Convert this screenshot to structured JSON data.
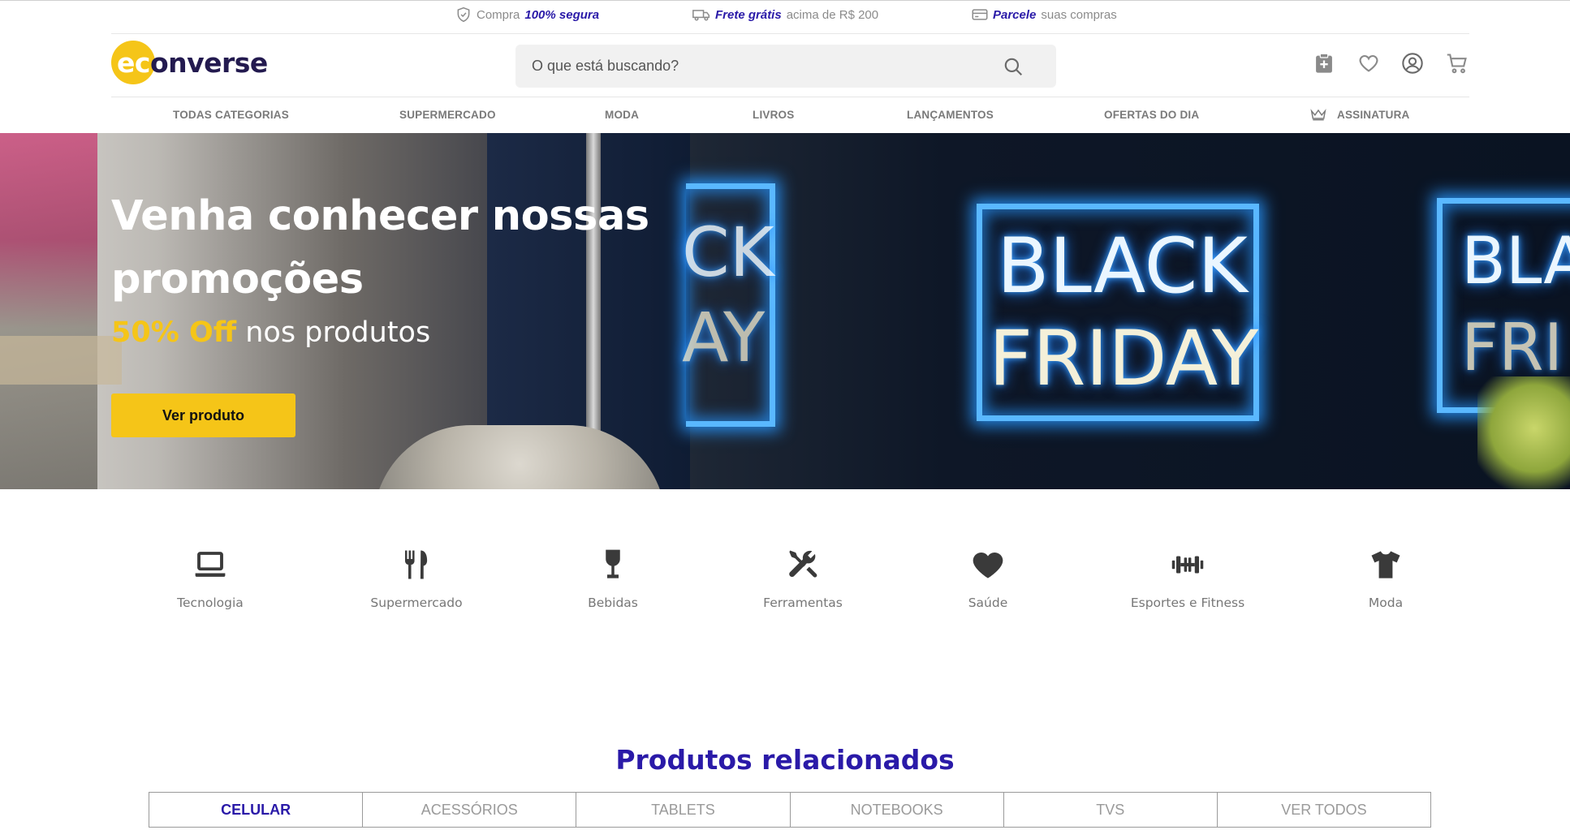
{
  "topbar": {
    "secure": {
      "prefix": "Compra",
      "highlight": "100% segura"
    },
    "shipping": {
      "highlight": "Frete grátis",
      "suffix": "acima de R$ 200"
    },
    "installments": {
      "highlight": "Parcele",
      "suffix": "suas compras"
    }
  },
  "header": {
    "logo": {
      "ec": "ec",
      "rest": "onverse"
    },
    "search_placeholder": "O que está buscando?"
  },
  "nav": {
    "items": [
      "TODAS CATEGORIAS",
      "SUPERMERCADO",
      "MODA",
      "LIVROS",
      "LANÇAMENTOS",
      "OFERTAS DO DIA",
      "ASSINATURA"
    ]
  },
  "hero": {
    "title": "Venha conhecer nossas promoções",
    "subtitle_highlight": "50% Off",
    "subtitle_rest": "nos produtos",
    "button": "Ver produto",
    "sign_line1": "BLACK",
    "sign_line2": "FRIDAY"
  },
  "categories": [
    {
      "label": "Tecnologia",
      "icon": "laptop-icon"
    },
    {
      "label": "Supermercado",
      "icon": "fork-knife-icon"
    },
    {
      "label": "Bebidas",
      "icon": "wine-glass-icon"
    },
    {
      "label": "Ferramentas",
      "icon": "tools-icon"
    },
    {
      "label": "Saúde",
      "icon": "heart-icon"
    },
    {
      "label": "Esportes e Fitness",
      "icon": "dumbbell-icon"
    },
    {
      "label": "Moda",
      "icon": "tshirt-icon"
    }
  ],
  "related": {
    "title": "Produtos relacionados",
    "tabs": [
      "CELULAR",
      "ACESSÓRIOS",
      "TABLETS",
      "NOTEBOOKS",
      "TVS",
      "VER TODOS"
    ],
    "active_tab": "CELULAR"
  },
  "colors": {
    "brand_yellow": "#f5c518",
    "brand_purple": "#2a1aa8",
    "logo_dark": "#231a4f",
    "neon_blue": "#5ab8ff"
  }
}
